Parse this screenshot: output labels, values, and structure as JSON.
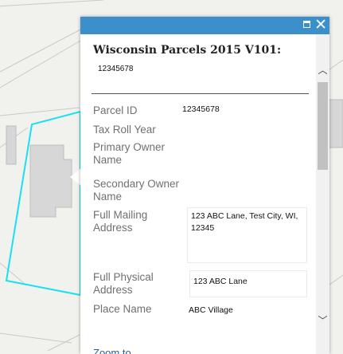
{
  "popup": {
    "title": "Wisconsin Parcels 2015 V101:",
    "title_value": "12345678",
    "fields": [
      {
        "label": "Parcel ID",
        "value": "12345678"
      },
      {
        "label": "Tax Roll Year",
        "value": ""
      },
      {
        "label": "Primary Owner Name",
        "value": ""
      },
      {
        "label": "Secondary Owner Name",
        "value": ""
      },
      {
        "label": "Full Mailing Address",
        "value": "123 ABC Lane, Test City, WI, 12345"
      },
      {
        "label": "Full Physical Address",
        "value": "123 ABC Lane"
      },
      {
        "label": "Place Name",
        "value": "ABC Village"
      }
    ],
    "zoom_link": "Zoom to"
  },
  "controls": {
    "maximize_icon": "maximize-icon",
    "close_icon": "close-icon",
    "close_glyph": "✕",
    "scroll_up_glyph": "︿",
    "scroll_down_glyph": "﹀"
  },
  "colors": {
    "titlebar": "#3b8fcb",
    "parcel_highlight": "#18e0f0",
    "link": "#2b5f8f"
  }
}
